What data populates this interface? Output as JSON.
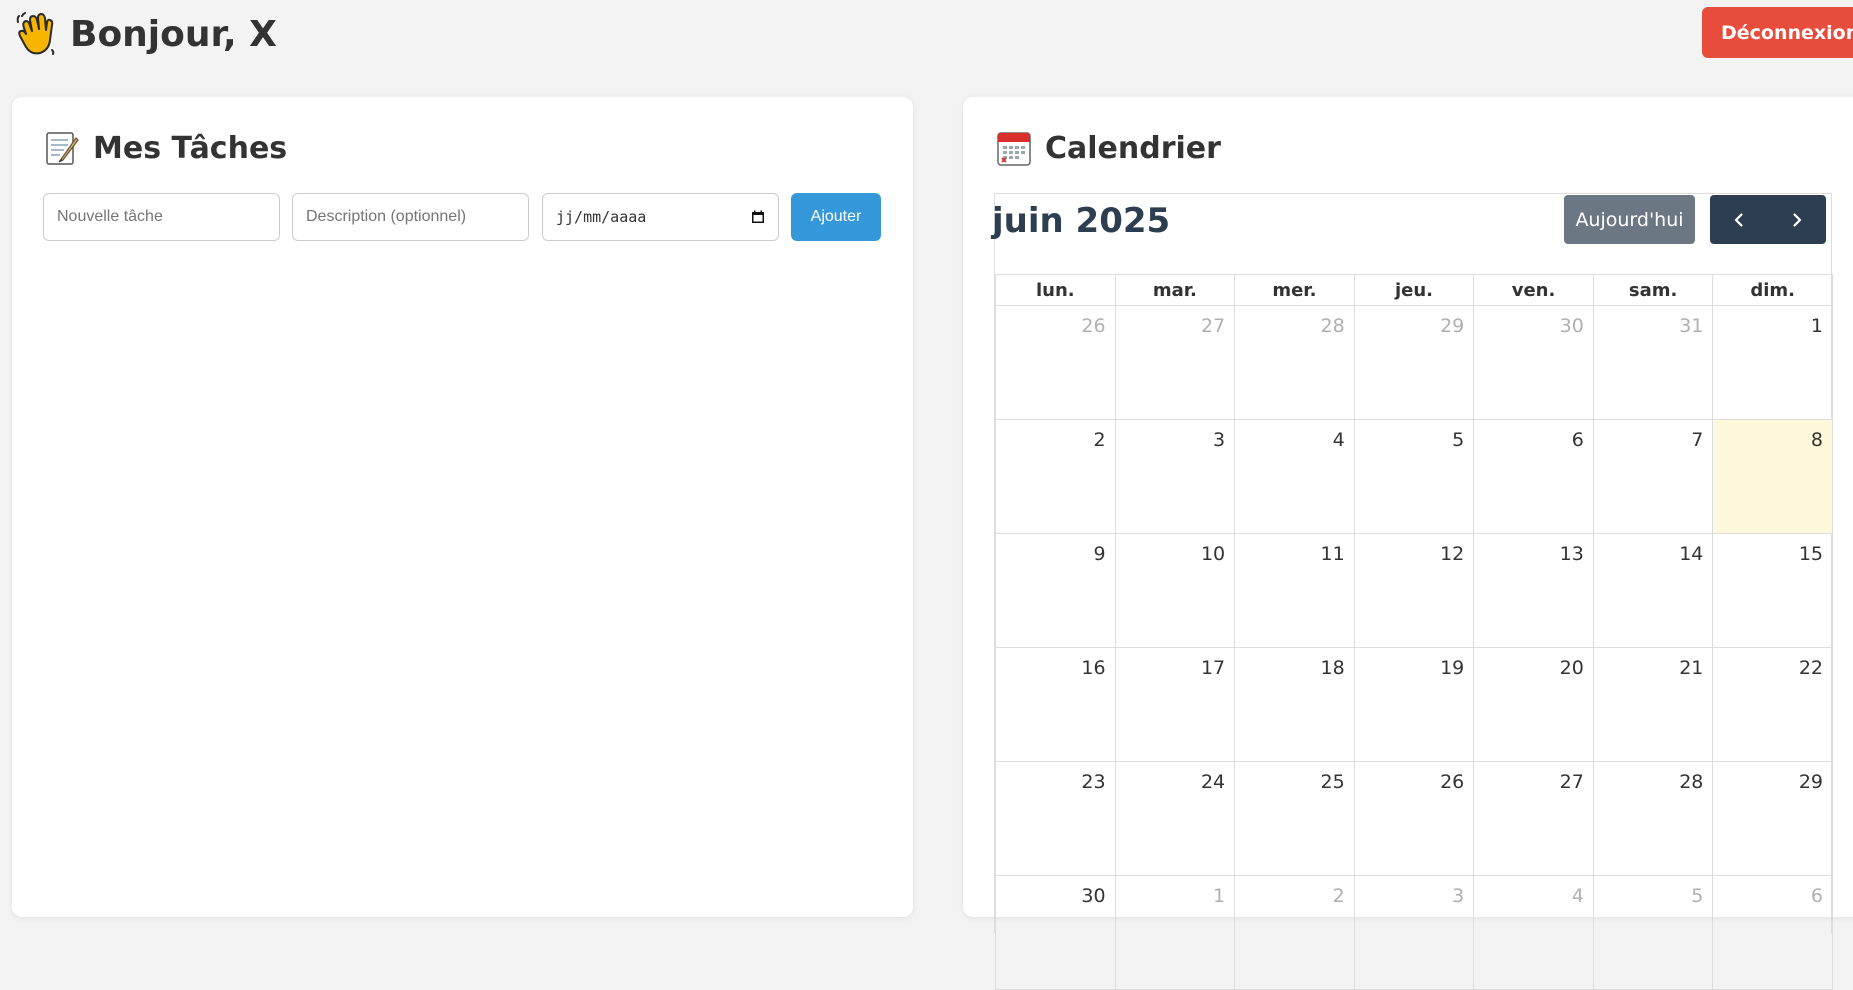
{
  "header": {
    "greeting": "Bonjour, X",
    "wave_icon": "waving-hand-icon",
    "logout_label": "Déconnexion",
    "logout_color": "#e74c3c"
  },
  "tasks": {
    "title": "Mes Tâches",
    "title_icon": "memo-icon",
    "form": {
      "title_placeholder": "Nouvelle tâche",
      "title_value": "",
      "description_placeholder": "Description (optionnel)",
      "description_value": "",
      "date_placeholder": "jj/mm/aaaa",
      "add_label": "Ajouter"
    },
    "accent_color": "#3498db"
  },
  "calendar": {
    "title": "Calendrier",
    "title_icon": "calendar-icon",
    "month_label": "juin 2025",
    "today_label": "Aujourd'hui",
    "prev_icon": "chevron-left-icon",
    "next_icon": "chevron-right-icon",
    "weekdays": [
      "lun.",
      "mar.",
      "mer.",
      "jeu.",
      "ven.",
      "sam.",
      "dim."
    ],
    "weeks": [
      [
        {
          "d": "26",
          "o": true
        },
        {
          "d": "27",
          "o": true
        },
        {
          "d": "28",
          "o": true
        },
        {
          "d": "29",
          "o": true
        },
        {
          "d": "30",
          "o": true
        },
        {
          "d": "31",
          "o": true
        },
        {
          "d": "1",
          "o": false
        }
      ],
      [
        {
          "d": "2",
          "o": false
        },
        {
          "d": "3",
          "o": false
        },
        {
          "d": "4",
          "o": false
        },
        {
          "d": "5",
          "o": false
        },
        {
          "d": "6",
          "o": false
        },
        {
          "d": "7",
          "o": false
        },
        {
          "d": "8",
          "o": false,
          "today": true
        }
      ],
      [
        {
          "d": "9",
          "o": false
        },
        {
          "d": "10",
          "o": false
        },
        {
          "d": "11",
          "o": false
        },
        {
          "d": "12",
          "o": false
        },
        {
          "d": "13",
          "o": false
        },
        {
          "d": "14",
          "o": false
        },
        {
          "d": "15",
          "o": false
        }
      ],
      [
        {
          "d": "16",
          "o": false
        },
        {
          "d": "17",
          "o": false
        },
        {
          "d": "18",
          "o": false
        },
        {
          "d": "19",
          "o": false
        },
        {
          "d": "20",
          "o": false
        },
        {
          "d": "21",
          "o": false
        },
        {
          "d": "22",
          "o": false
        }
      ],
      [
        {
          "d": "23",
          "o": false
        },
        {
          "d": "24",
          "o": false
        },
        {
          "d": "25",
          "o": false
        },
        {
          "d": "26",
          "o": false
        },
        {
          "d": "27",
          "o": false
        },
        {
          "d": "28",
          "o": false
        },
        {
          "d": "29",
          "o": false
        }
      ],
      [
        {
          "d": "30",
          "o": false
        },
        {
          "d": "1",
          "o": true
        },
        {
          "d": "2",
          "o": true
        },
        {
          "d": "3",
          "o": true
        },
        {
          "d": "4",
          "o": true
        },
        {
          "d": "5",
          "o": true
        },
        {
          "d": "6",
          "o": true
        }
      ]
    ],
    "today_highlight": "#fef8dd"
  }
}
